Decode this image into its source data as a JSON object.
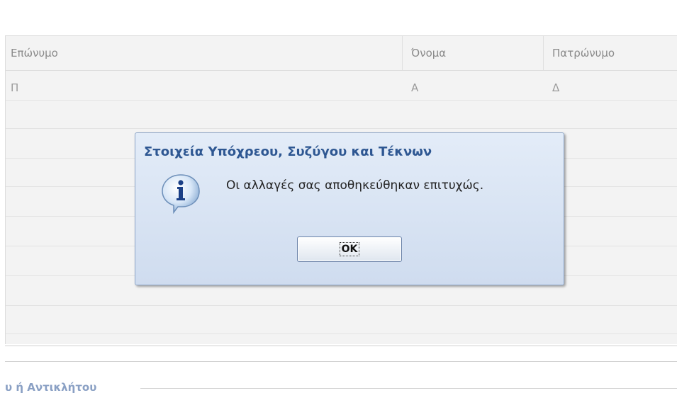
{
  "table": {
    "columns": [
      "Επώνυμο",
      "Όνομα",
      "Πατρώνυμο"
    ],
    "rows": [
      [
        "Π",
        "Α",
        "Δ"
      ]
    ]
  },
  "section": {
    "legend_text": "υ ή Αντικλήτου"
  },
  "dialog": {
    "title": "Στοιχεία Υπόχρεου, Συζύγου και Τέκνων",
    "message": "Οι αλλαγές σας αποθηκεύθηκαν επιτυχώς.",
    "ok_label": "OK",
    "icon": "info-icon"
  },
  "colors": {
    "dialog_title": "#2e5792",
    "dialog_bg": "#d8e3f3",
    "legend": "#8aa0c4"
  }
}
